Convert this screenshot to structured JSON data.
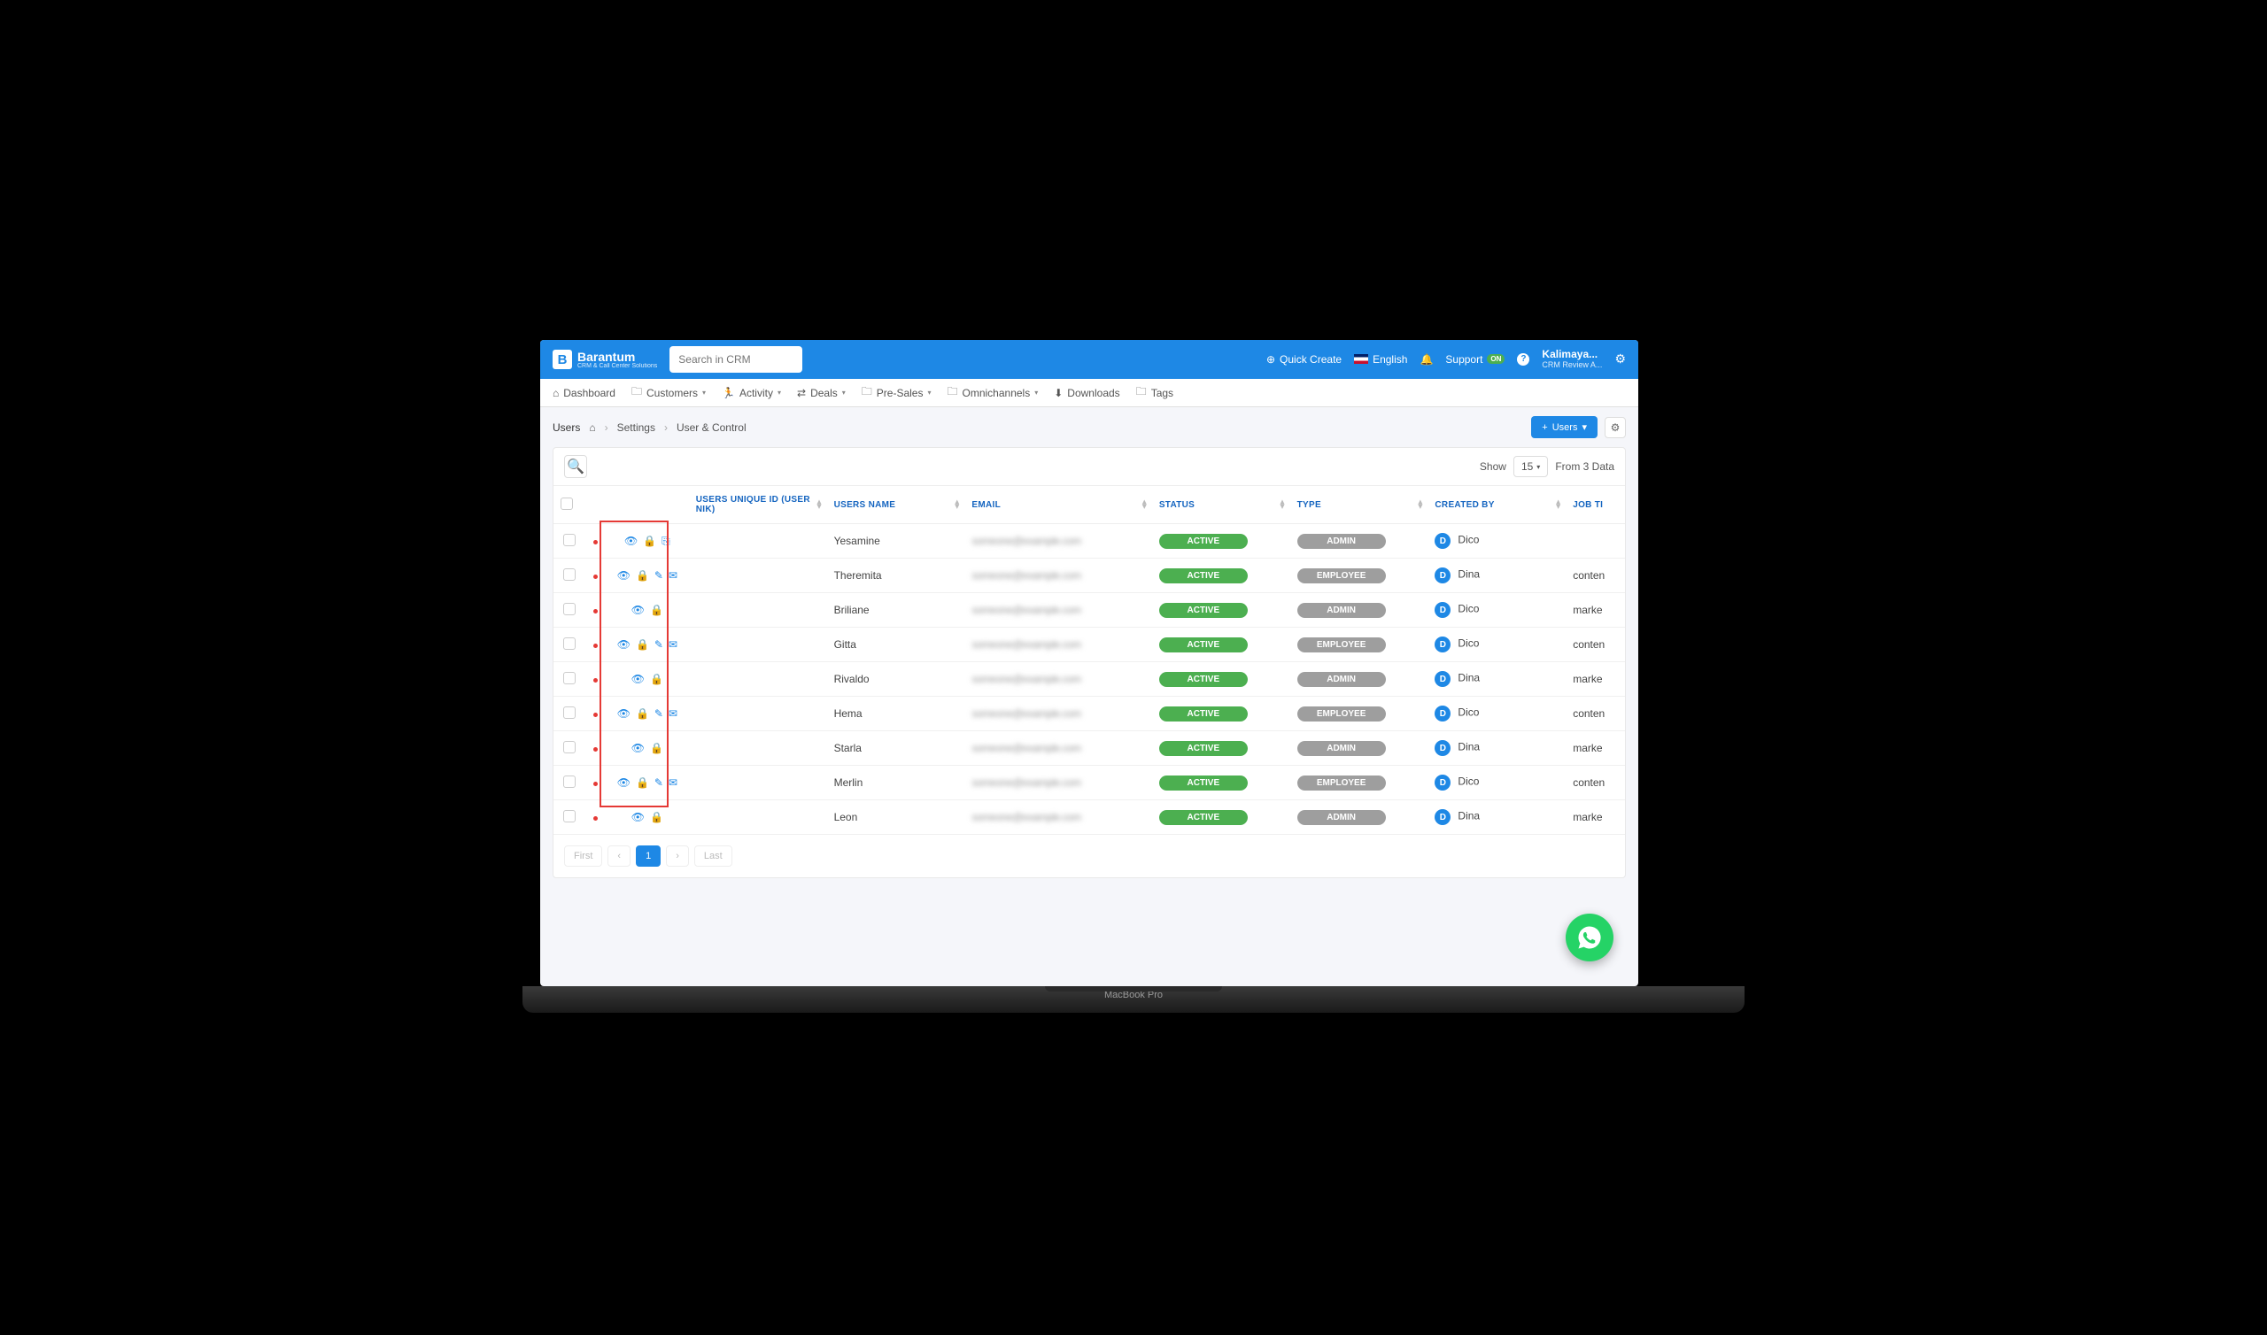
{
  "app": {
    "brand": "Barantum",
    "brand_sub": "CRM & Call Center Solutions",
    "search_placeholder": "Search in CRM"
  },
  "topbar": {
    "quick_create": "Quick Create",
    "language": "English",
    "support": "Support",
    "support_badge": "ON",
    "user_name": "Kalimaya...",
    "user_role": "CRM Review A..."
  },
  "nav": {
    "dashboard": "Dashboard",
    "customers": "Customers",
    "activity": "Activity",
    "deals": "Deals",
    "presales": "Pre-Sales",
    "omnichannels": "Omnichannels",
    "downloads": "Downloads",
    "tags": "Tags"
  },
  "subhead": {
    "title": "Users",
    "bc1": "Settings",
    "bc2": "User & Control",
    "btn_users": "Users"
  },
  "toolbar": {
    "show": "Show",
    "page_size": "15",
    "from_data": "From 3 Data"
  },
  "columns": {
    "uid": "USERS UNIQUE ID (USER NIK)",
    "name": "USERS NAME",
    "email": "EMAIL",
    "status": "STATUS",
    "type": "TYPE",
    "created_by": "CREATED BY",
    "job": "JOB TI"
  },
  "status_labels": {
    "active": "ACTIVE"
  },
  "type_labels": {
    "admin": "ADMIN",
    "employee": "EMPLOYEE"
  },
  "rows": [
    {
      "name": "Yesamine",
      "status": "active",
      "type": "admin",
      "created_by": "Dico",
      "job": "",
      "actions": [
        "view",
        "lock",
        "login"
      ]
    },
    {
      "name": "Theremita",
      "status": "active",
      "type": "employee",
      "created_by": "Dina",
      "job": "conten",
      "actions": [
        "view",
        "lock",
        "edit",
        "mail"
      ]
    },
    {
      "name": "Briliane",
      "status": "active",
      "type": "admin",
      "created_by": "Dico",
      "job": "marke",
      "actions": [
        "view",
        "lock"
      ]
    },
    {
      "name": "Gitta",
      "status": "active",
      "type": "employee",
      "created_by": "Dico",
      "job": "conten",
      "actions": [
        "view",
        "lock",
        "edit",
        "mail"
      ]
    },
    {
      "name": "Rivaldo",
      "status": "active",
      "type": "admin",
      "created_by": "Dina",
      "job": "marke",
      "actions": [
        "view",
        "lock"
      ]
    },
    {
      "name": "Hema",
      "status": "active",
      "type": "employee",
      "created_by": "Dico",
      "job": "conten",
      "actions": [
        "view",
        "lock",
        "edit",
        "mail"
      ]
    },
    {
      "name": "Starla",
      "status": "active",
      "type": "admin",
      "created_by": "Dina",
      "job": "marke",
      "actions": [
        "view",
        "lock"
      ]
    },
    {
      "name": "Merlin",
      "status": "active",
      "type": "employee",
      "created_by": "Dico",
      "job": "conten",
      "actions": [
        "view",
        "lock",
        "edit",
        "mail"
      ]
    },
    {
      "name": "Leon",
      "status": "active",
      "type": "admin",
      "created_by": "Dina",
      "job": "marke",
      "actions": [
        "view",
        "lock"
      ]
    }
  ],
  "pagination": {
    "first": "First",
    "page": "1",
    "last": "Last"
  },
  "device": {
    "label": "MacBook Pro"
  },
  "icons": {
    "view": "👁",
    "lock": "🔒",
    "edit": "✎",
    "mail": "✉",
    "login": "⎘"
  }
}
